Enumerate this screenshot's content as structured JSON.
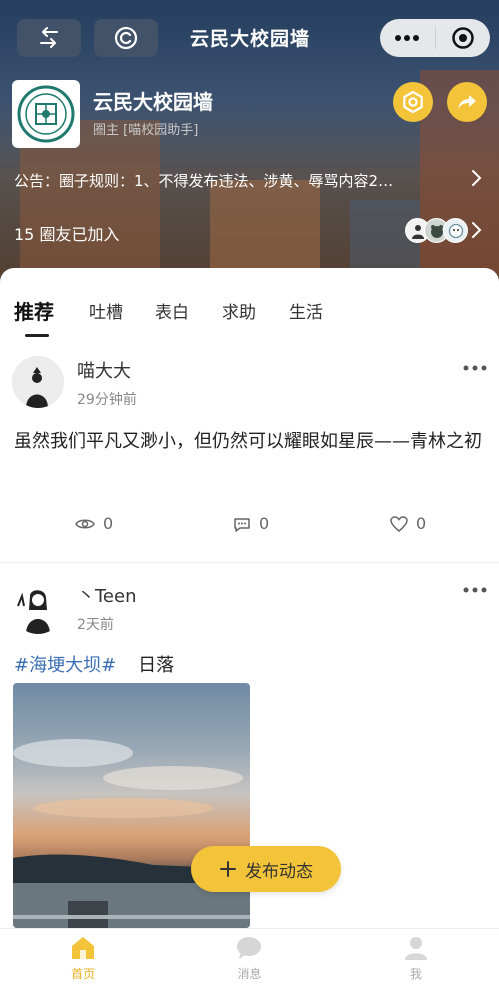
{
  "nav": {
    "title": "云民大校园墙"
  },
  "circle": {
    "name": "云民大校园墙",
    "owner": "圈主 [喵校园助手]",
    "notice": "公告：圈子规则：1、不得发布违法、涉黄、辱骂内容2…",
    "members": "15 圈友已加入"
  },
  "tabs": [
    "推荐",
    "吐槽",
    "表白",
    "求助",
    "生活"
  ],
  "posts": [
    {
      "author": "喵大大",
      "time": "29分钟前",
      "text": "虽然我们平凡又渺小，但仍然可以耀眼如星辰——青林之初",
      "views": "0",
      "comments": "0",
      "likes": "0"
    },
    {
      "author": "丶Teen",
      "time": "2天前",
      "topic": "#海埂大坝#",
      "text": "日落"
    }
  ],
  "fab": {
    "label": "发布动态"
  },
  "tabbar": [
    {
      "label": "首页",
      "icon": "home-icon"
    },
    {
      "label": "消息",
      "icon": "message-icon"
    },
    {
      "label": "我",
      "icon": "user-icon"
    }
  ],
  "colors": {
    "accent": "#f3c43a",
    "topic": "#3b6fb5"
  }
}
